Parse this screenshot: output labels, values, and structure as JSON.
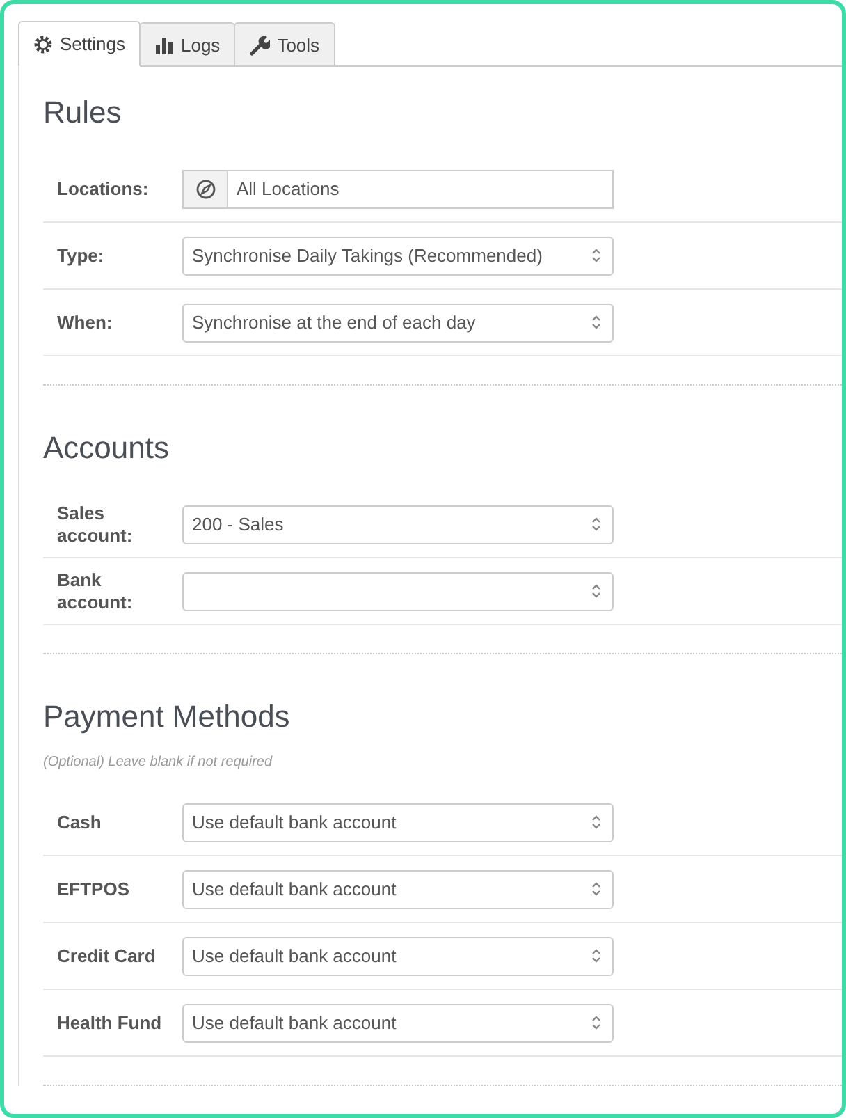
{
  "tabs": [
    {
      "label": "Settings",
      "kind": "gear",
      "selected": true
    },
    {
      "label": "Logs",
      "kind": "bars",
      "selected": false
    },
    {
      "label": "Tools",
      "kind": "wrench",
      "selected": false
    }
  ],
  "sections": [
    {
      "title": "Rules",
      "rows": [
        {
          "label": "Locations:",
          "kind": "location",
          "value": "All Locations"
        },
        {
          "label": "Type:",
          "kind": "select",
          "value": "Synchronise Daily Takings (Recommended)"
        },
        {
          "label": "When:",
          "kind": "select",
          "value": "Synchronise at the end of each day"
        }
      ]
    },
    {
      "title": "Accounts",
      "rows": [
        {
          "label": "Sales account:",
          "kind": "select",
          "value": "200 - Sales"
        },
        {
          "label": "Bank account:",
          "kind": "select"
        }
      ]
    },
    {
      "title": "Payment Methods",
      "note": "(Optional) Leave blank if not required",
      "rows": [
        {
          "label": "Cash",
          "kind": "select",
          "value": "Use default bank account"
        },
        {
          "label": "EFTPOS",
          "kind": "select",
          "value": "Use default bank account"
        },
        {
          "label": "Credit Card",
          "kind": "select",
          "value": "Use default bank account"
        },
        {
          "label": "Health Fund",
          "kind": "select",
          "value": "Use default bank account"
        }
      ]
    }
  ]
}
